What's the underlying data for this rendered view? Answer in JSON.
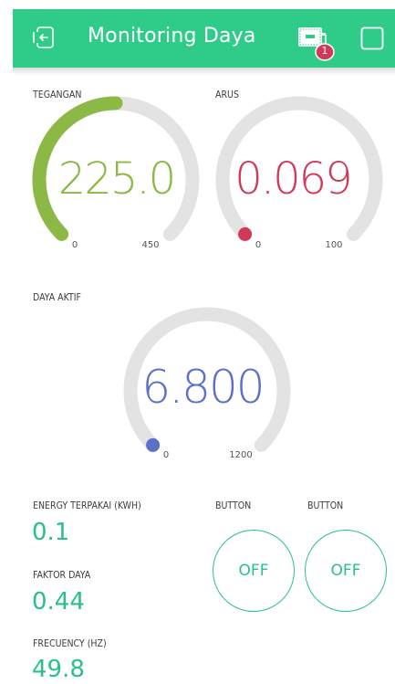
{
  "header": {
    "title": "Monitoring Daya",
    "notification_count": "1",
    "icons": [
      "exit-icon",
      "device-icon",
      "square-icon"
    ]
  },
  "gauges": {
    "tegangan": {
      "label": "TEGANGAN",
      "value": "225.0",
      "min": "0",
      "max": "450",
      "fraction": 0.5,
      "color": "#8cb846"
    },
    "arus": {
      "label": "ARUS",
      "value": "0.069",
      "min": "0",
      "max": "100",
      "fraction": 0.0007,
      "color": "#d1395a"
    },
    "daya_aktif": {
      "label": "DAYA AKTIF",
      "value": "6.800",
      "min": "0",
      "max": "1200",
      "fraction": 0.0057,
      "color": "#5c70c9"
    }
  },
  "displays": {
    "energy": {
      "label": "ENERGY TERPAKAI (KWH)",
      "value": "0.1"
    },
    "faktor_daya": {
      "label": "FAKTOR DAYA",
      "value": "0.44"
    },
    "frequency": {
      "label": "FRECUENCY (HZ)",
      "value": "49.8"
    }
  },
  "buttons": [
    {
      "label": "BUTTON",
      "state": "OFF"
    },
    {
      "label": "BUTTON",
      "state": "OFF"
    }
  ],
  "colors": {
    "accent": "#2ecc88",
    "track": "#e3e3e3"
  }
}
